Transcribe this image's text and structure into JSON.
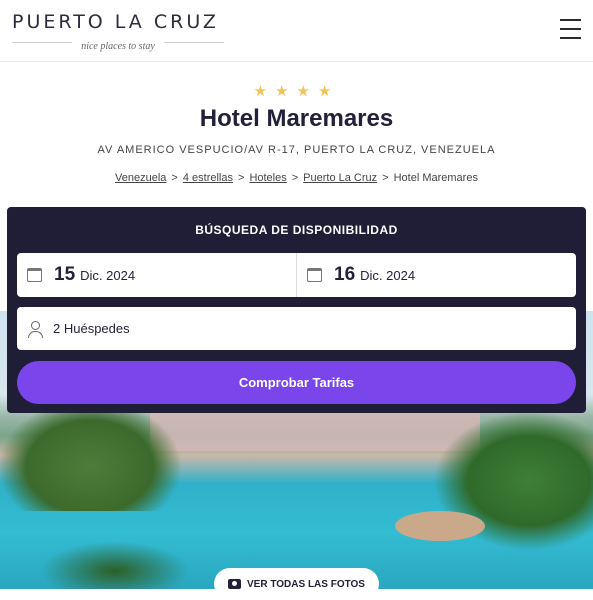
{
  "header": {
    "logo_title": "PUERTO LA CRUZ",
    "logo_tagline": "nice places to stay",
    "menu_icon": "hamburger-menu-icon"
  },
  "hotel": {
    "stars": "★★★★",
    "star_rating": 4,
    "name": "Hotel Maremares",
    "address": "AV AMERICO VESPUCIO/AV R-17, PUERTO LA CRUZ, VENEZUELA"
  },
  "breadcrumb": {
    "items": [
      "Venezuela",
      "4 estrellas",
      "Hoteles",
      "Puerto La Cruz"
    ],
    "separator": ">",
    "current": "Hotel Maremares"
  },
  "search": {
    "title": "BÚSQUEDA DE DISPONIBILIDAD",
    "checkin": {
      "day": "15",
      "month": "Dic. 2024"
    },
    "checkout": {
      "day": "16",
      "month": "Dic. 2024"
    },
    "guests": "2 Huéspedes",
    "submit_label": "Comprobar Tarifas"
  },
  "gallery": {
    "button_label": "VER TODAS LAS FOTOS"
  },
  "colors": {
    "panel_bg": "#201d36",
    "accent": "#7a46eb",
    "star": "#f2c45c"
  }
}
